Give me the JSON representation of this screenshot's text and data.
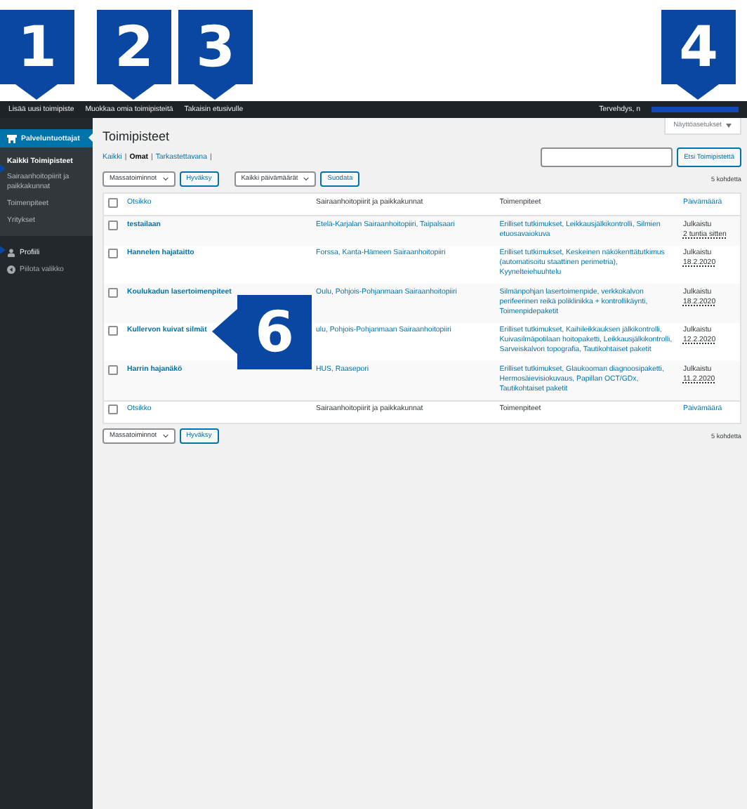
{
  "annotations": [
    {
      "kind": "down",
      "label": "1"
    },
    {
      "kind": "down",
      "label": "2"
    },
    {
      "kind": "down",
      "label": "3"
    },
    {
      "kind": "down",
      "label": "4"
    },
    {
      "kind": "left",
      "label": "6"
    },
    {
      "kind": "edge"
    },
    {
      "kind": "edge"
    }
  ],
  "admin_bar": {
    "links": [
      "Lisää uusi toimipiste",
      "Muokkaa omia toimipisteitä",
      "Takaisin etusivulle"
    ],
    "greeting": "Tervehdys, n"
  },
  "sidebar": {
    "section": {
      "label": "Palveluntuottajat",
      "selected": true
    },
    "items": [
      {
        "label": "Kaikki Toimipisteet",
        "selected": true
      },
      {
        "label": "Sairaanhoitopiirit ja paikkakunnat",
        "selected": false
      },
      {
        "label": "Toimenpiteet",
        "selected": false
      },
      {
        "label": "Yritykset",
        "selected": false
      }
    ],
    "menu": [
      {
        "kind": "profile",
        "label": "Profiili"
      },
      {
        "kind": "collapse",
        "label": "Piilota valikko"
      }
    ]
  },
  "screen_options": "Näyttöasetukset",
  "page_title": "Toimipisteet",
  "views": [
    {
      "label": "Kaikki",
      "selected": false
    },
    {
      "label": "Omat",
      "selected": true
    },
    {
      "label": "Tarkastettavana",
      "selected": false
    }
  ],
  "view_separator": "|",
  "search_button": "Etsi Toimipistettä",
  "top_actions": {
    "bulk_select": "Massatoiminnot",
    "apply": "Hyväksy",
    "date_select": "Kaikki päivämäärät",
    "filter": "Suodata",
    "count": "5 kohdetta"
  },
  "table_header": {
    "checked": false,
    "columns": [
      {
        "kind": "link",
        "label": "Otsikko"
      },
      {
        "kind": "text",
        "label": "Sairaanhoitopiirit ja paikkakunnat"
      },
      {
        "kind": "text",
        "label": "Toimenpiteet"
      },
      {
        "kind": "link",
        "label": "Päivämäärä"
      }
    ]
  },
  "rows": [
    {
      "title": "testailaan",
      "places": "Etelä-Karjalan Sairaanhoitopiiri, Taipalsaari",
      "actions": "Erilliset tutkimukset, Leikkausjälkikontrolli, Silmien etuosavaiokuva",
      "status": "Julkaistu",
      "date": "2 tuntia sitten",
      "checked": false
    },
    {
      "title": "Hannelen hajataitto",
      "places": "Forssa, Kanta-Hämeen Sairaanhoitopiiri",
      "actions": "Erilliset tutkimukset, Keskeinen näkökenttätutkimus (automatisoitu staattinen perimetria), Kyynelteiehuuhtelu",
      "status": "Julkaistu",
      "date": "18.2.2020",
      "checked": false
    },
    {
      "title": "Koulukadun lasertoimenpiteet",
      "places": "Oulu, Pohjois-Pohjanmaan Sairaanhoitopiiri",
      "actions": "Silmänpohjan lasertoimenpide, verkkokalvon perifeerinen reikä poliklinikka + kontrollikäynti, Toimenpidepaketit",
      "status": "Julkaistu",
      "date": "18.2.2020",
      "checked": false
    },
    {
      "title": "Kullervon kuivat silmät",
      "places": "ulu, Pohjois-Pohjanmaan Sairaanhoitopiiri",
      "actions": "Erilliset tutkimukset, Kaihileikkauksen jälkikontrolli, Kuivasilmäpotilaan hoitopaketti, Leikkausjälkikontrolli, Sarveiskalvon topografia, Tautikohtaiset paketit",
      "status": "Julkaistu",
      "date": "12.2.2020",
      "checked": false
    },
    {
      "title": "Harrin hajanäkö",
      "places": "HUS, Raasepori",
      "actions": "Erilliset tutkimukset, Glaukooman diagnoosipaketti, Hermosäievisiokuvaus, Papillan OCT/GDx, Tautikohtaiset paketit",
      "status": "Julkaistu",
      "date": "11.2.2020",
      "checked": false
    }
  ],
  "table_footer": {
    "checked": false,
    "columns": [
      {
        "kind": "link",
        "label": "Otsikko"
      },
      {
        "kind": "text",
        "label": "Sairaanhoitopiirit ja paikkakunnat"
      },
      {
        "kind": "text",
        "label": "Toimenpiteet"
      },
      {
        "kind": "link",
        "label": "Päivämäärä"
      }
    ]
  },
  "bottom_actions": {
    "bulk_select": "Massatoiminnot",
    "apply": "Hyväksy",
    "count": "5 kohdetta"
  }
}
